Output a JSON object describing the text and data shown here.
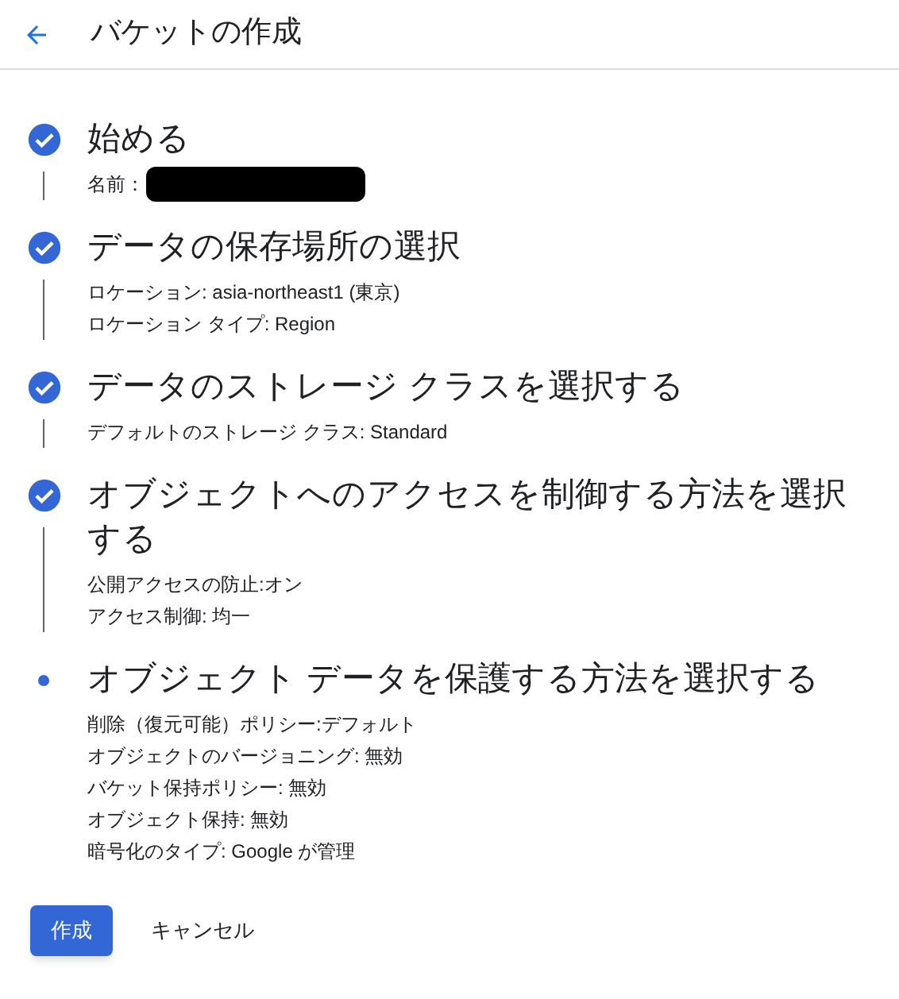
{
  "header": {
    "title": "バケットの作成"
  },
  "steps": [
    {
      "kind": "done",
      "title": "始める",
      "details": [
        {
          "text": "名前：",
          "redacted": true
        }
      ]
    },
    {
      "kind": "done",
      "title": "データの保存場所の選択",
      "details": [
        {
          "text": "ロケーション: asia-northeast1 (東京)"
        },
        {
          "text": "ロケーション タイプ: Region"
        }
      ]
    },
    {
      "kind": "done",
      "title": "データのストレージ クラスを選択する",
      "details": [
        {
          "text": "デフォルトのストレージ クラス: Standard"
        }
      ]
    },
    {
      "kind": "done",
      "title": "オブジェクトへのアクセスを制御する方法を選択する",
      "details": [
        {
          "text": "公開アクセスの防止:オン"
        },
        {
          "text": "アクセス制御: 均一"
        }
      ]
    },
    {
      "kind": "current",
      "title": "オブジェクト データを保護する方法を選択する",
      "details": [
        {
          "text": "削除（復元可能）ポリシー:デフォルト"
        },
        {
          "text": "オブジェクトのバージョニング: 無効"
        },
        {
          "text": "バケット保持ポリシー: 無効"
        },
        {
          "text": "オブジェクト保持: 無効"
        },
        {
          "text": "暗号化のタイプ: Google が管理"
        }
      ]
    }
  ],
  "buttons": [
    {
      "kind": "primary",
      "label": "作成"
    },
    {
      "kind": "text",
      "label": "キャンセル"
    }
  ]
}
